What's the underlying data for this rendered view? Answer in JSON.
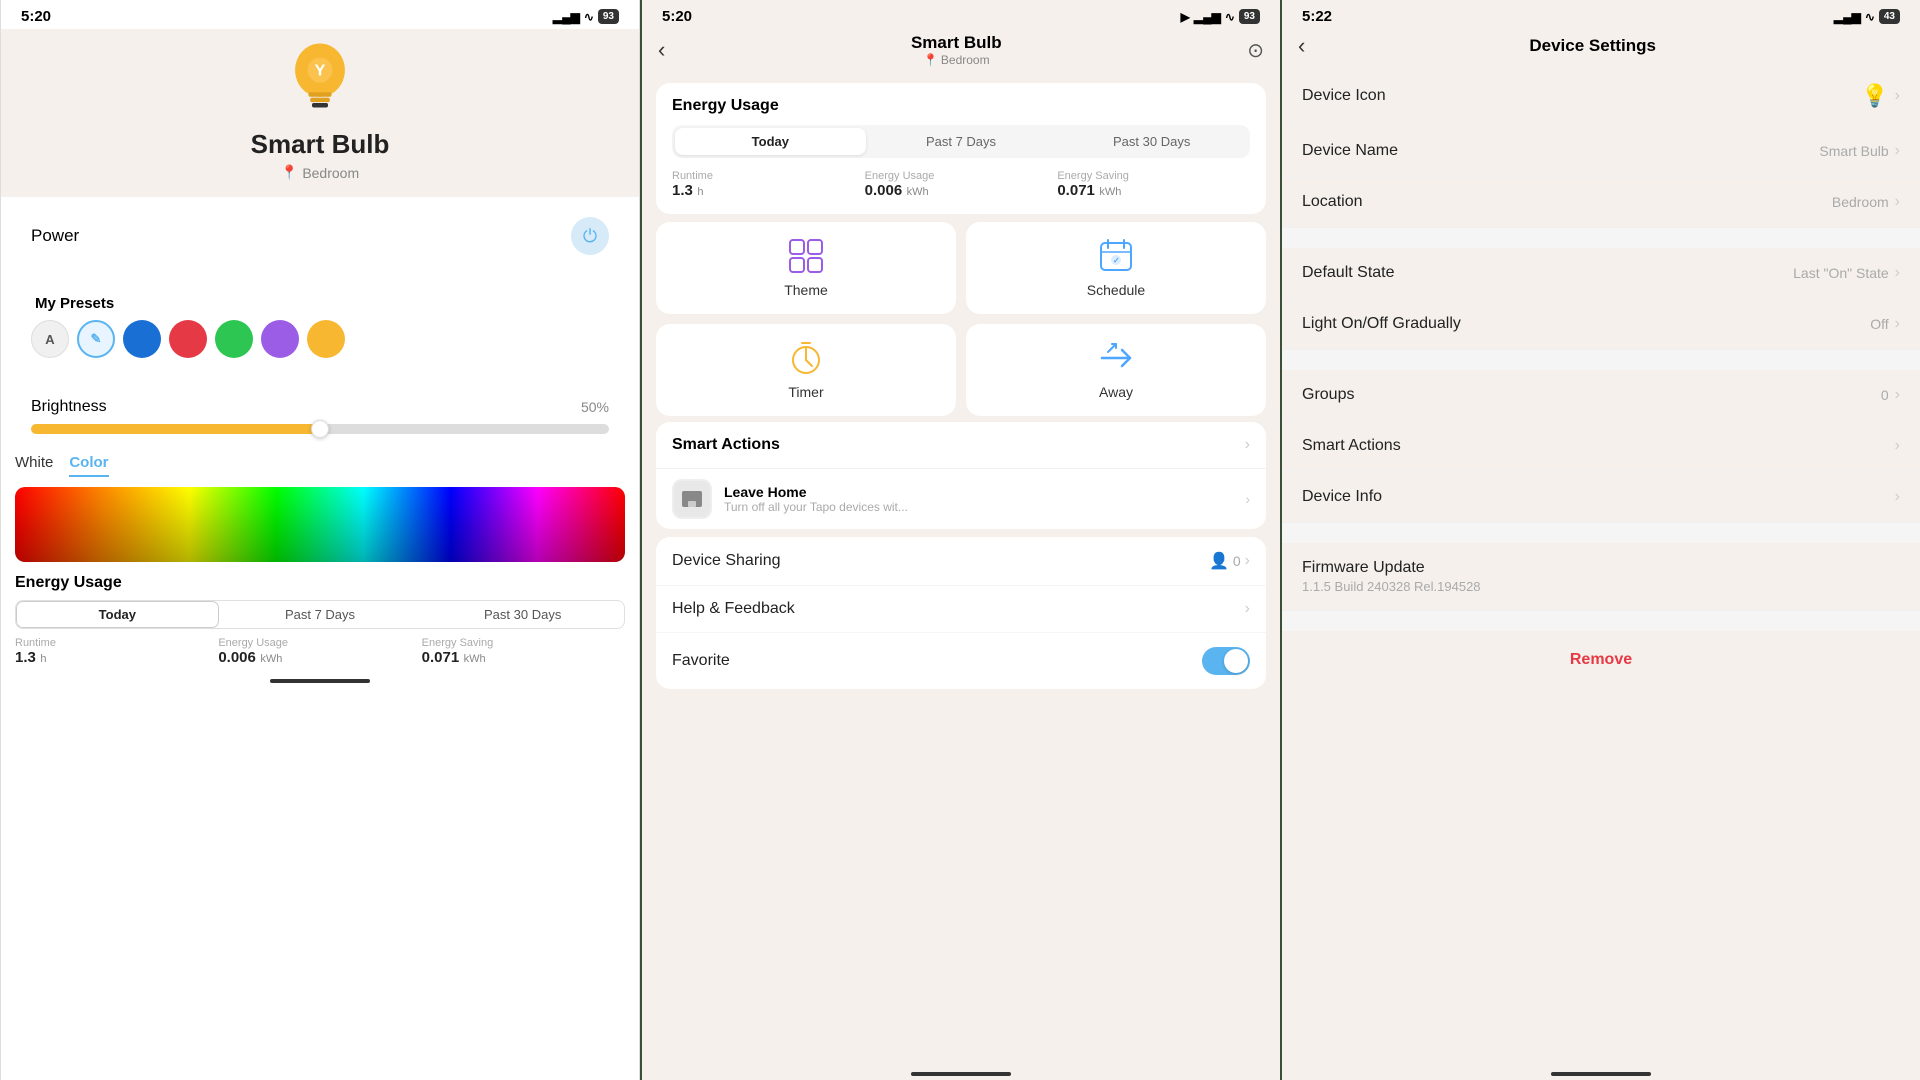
{
  "panel1": {
    "statusBar": {
      "time": "5:20",
      "battery": "93"
    },
    "deviceName": "Smart Bulb",
    "location": "Bedroom",
    "power": {
      "label": "Power"
    },
    "presets": {
      "label": "My Presets",
      "items": [
        "A",
        "✎",
        "",
        "",
        "",
        "",
        ""
      ]
    },
    "brightness": {
      "label": "Brightness",
      "value": "50%"
    },
    "colorTabs": {
      "white": "White",
      "color": "Color"
    },
    "energyUsage": {
      "title": "Energy Usage",
      "tabs": [
        "Today",
        "Past 7 Days",
        "Past 30 Days"
      ],
      "stats": {
        "runtime": {
          "label": "Runtime",
          "value": "1.3",
          "unit": "h"
        },
        "energyUsage": {
          "label": "Energy Usage",
          "value": "0.006",
          "unit": "kWh"
        },
        "energySaving": {
          "label": "Energy Saving",
          "value": "0.071",
          "unit": "kWh"
        }
      }
    }
  },
  "panel2": {
    "statusBar": {
      "time": "5:20",
      "battery": "93"
    },
    "header": {
      "title": "Smart Bulb",
      "subtitle": "Bedroom"
    },
    "energyUsage": {
      "title": "Energy Usage",
      "tabs": [
        "Today",
        "Past 7 Days",
        "Past 30 Days"
      ],
      "stats": {
        "runtime": {
          "label": "Runtime",
          "value": "1.3",
          "unit": "h"
        },
        "energyUsage": {
          "label": "Energy Usage",
          "value": "0.006",
          "unit": "kWh"
        },
        "energySaving": {
          "label": "Energy Saving",
          "value": "0.071",
          "unit": "kWh"
        }
      }
    },
    "gridItems": [
      {
        "label": "Theme",
        "icon": "theme"
      },
      {
        "label": "Schedule",
        "icon": "schedule"
      },
      {
        "label": "Timer",
        "icon": "timer"
      },
      {
        "label": "Away",
        "icon": "away"
      }
    ],
    "smartActions": {
      "title": "Smart Actions",
      "items": [
        {
          "title": "Leave Home",
          "subtitle": "Turn off all your Tapo devices wit..."
        }
      ]
    },
    "listItems": [
      {
        "label": "Device Sharing",
        "badge": "0",
        "hasBadge": true
      },
      {
        "label": "Help & Feedback",
        "hasBadge": false
      },
      {
        "label": "Favorite",
        "hasToggle": true
      }
    ]
  },
  "panel3": {
    "statusBar": {
      "time": "5:22",
      "battery": "43"
    },
    "header": {
      "title": "Device Settings"
    },
    "items": [
      {
        "label": "Device Icon",
        "value": ""
      },
      {
        "label": "Device Name",
        "value": "Smart Bulb"
      },
      {
        "label": "Location",
        "value": "Bedroom"
      }
    ],
    "section2": [
      {
        "label": "Default State",
        "value": "Last \"On\" State"
      },
      {
        "label": "Light On/Off Gradually",
        "value": "Off"
      }
    ],
    "section3": [
      {
        "label": "Groups",
        "value": "0"
      },
      {
        "label": "Smart Actions",
        "value": ""
      },
      {
        "label": "Device Info",
        "value": ""
      }
    ],
    "firmware": {
      "label": "Firmware Update",
      "version": "1.1.5 Build 240328 Rel.194528"
    },
    "removeLabel": "Remove"
  }
}
